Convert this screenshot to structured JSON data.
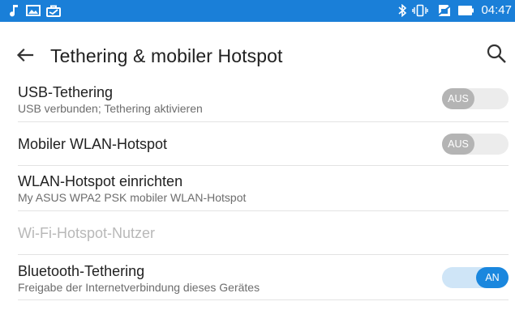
{
  "status_bar": {
    "time": "04:47",
    "background_color": "#1a7fd8",
    "left_icons": [
      "music-note-icon",
      "gallery-icon",
      "briefcase-icon"
    ],
    "right_icons": [
      "bluetooth-icon",
      "vibrate-icon",
      "no-sim-icon",
      "battery-icon"
    ]
  },
  "header": {
    "title": "Tethering & mobiler Hotspot",
    "back_icon": "arrow-left-icon",
    "search_icon": "search-icon"
  },
  "settings": {
    "usb_tethering": {
      "title": "USB-Tethering",
      "summary": "USB verbunden; Tethering aktivieren",
      "toggle_label": "AUS",
      "enabled": false
    },
    "wlan_hotspot": {
      "title": "Mobiler WLAN-Hotspot",
      "toggle_label": "AUS",
      "enabled": false
    },
    "hotspot_setup": {
      "title": "WLAN-Hotspot einrichten",
      "summary": "My ASUS WPA2 PSK mobiler WLAN-Hotspot"
    },
    "hotspot_users": {
      "title": "Wi-Fi-Hotspot-Nutzer",
      "disabled": true
    },
    "bluetooth_tethering": {
      "title": "Bluetooth-Tethering",
      "summary": "Freigabe der Internetverbindung dieses Gerätes",
      "toggle_label": "AN",
      "enabled": true
    }
  },
  "colors": {
    "accent": "#1a87de",
    "toggle_off_knob": "#b4b4b4",
    "toggle_off_track": "#ececec",
    "toggle_on_track": "#cfe5f7",
    "primary_text": "#212121",
    "secondary_text": "#6d6d6d",
    "disabled_text": "#b8b8b8"
  }
}
